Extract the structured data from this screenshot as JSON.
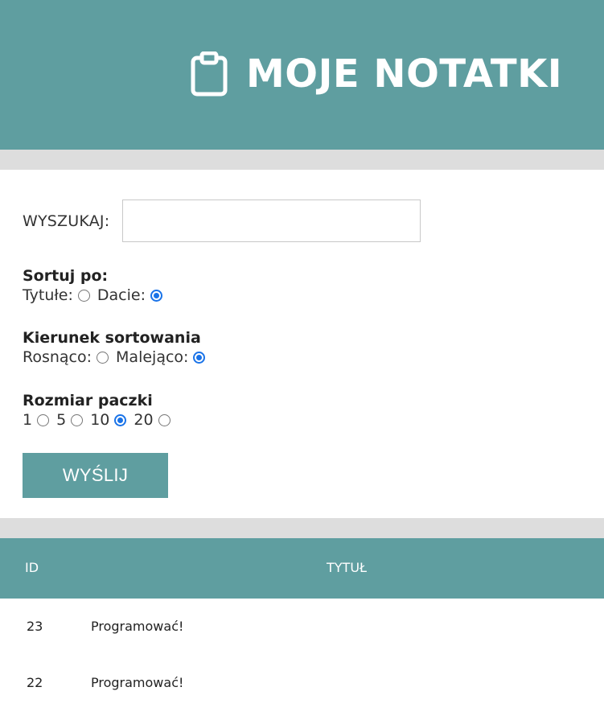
{
  "header": {
    "title": "MOJE NOTATKI",
    "icon": "clipboard-icon"
  },
  "search": {
    "label": "WYSZUKAJ:",
    "value": "",
    "placeholder": ""
  },
  "sort_by": {
    "title": "Sortuj po:",
    "options": [
      {
        "label": "Tytułe:",
        "checked": false
      },
      {
        "label": "Dacie:",
        "checked": true
      }
    ]
  },
  "sort_direction": {
    "title": "Kierunek sortowania",
    "options": [
      {
        "label": "Rosnąco:",
        "checked": false
      },
      {
        "label": "Malejąco:",
        "checked": true
      }
    ]
  },
  "page_size": {
    "title": "Rozmiar paczki",
    "options": [
      {
        "label": "1",
        "checked": false
      },
      {
        "label": "5",
        "checked": false
      },
      {
        "label": "10",
        "checked": true
      },
      {
        "label": "20",
        "checked": false
      }
    ]
  },
  "submit_label": "WYŚLIJ",
  "table": {
    "headers": {
      "id": "ID",
      "title": "TYTUŁ"
    },
    "rows": [
      {
        "id": "23",
        "title": "Programować!"
      },
      {
        "id": "22",
        "title": "Programować!"
      }
    ]
  },
  "colors": {
    "accent": "#5f9ea0",
    "band": "#dddddd",
    "radio_checked": "#1a73e8"
  }
}
